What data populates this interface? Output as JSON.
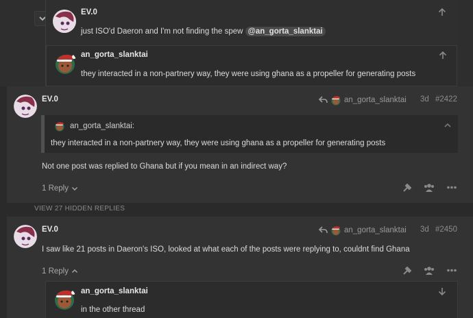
{
  "thread": {
    "top_nested": [
      {
        "username": "EV.0",
        "text": "just ISO'd Daeron and I'm not finding the spew",
        "mention": "@an_gorta_slanktai",
        "avatar": "ev0-avatar"
      },
      {
        "username": "an_gorta_slanktai",
        "text": "they interacted in a non-partnery way, they were using ghana as a propeller for generating posts",
        "avatar": "santa-hat-avatar"
      }
    ],
    "posts": [
      {
        "username": "EV.0",
        "reply_to": "an_gorta_slanktai",
        "age": "3d",
        "number": "#2422",
        "quote_author": "an_gorta_slanktai:",
        "quote_text": "they interacted in a non-partnery way, they were using ghana as a propeller for generating posts",
        "body": "Not one post was replied to Ghana but if you mean in an indirect way?",
        "replies_label": "1 Reply"
      },
      {
        "username": "EV.0",
        "reply_to": "an_gorta_slanktai",
        "age": "3d",
        "number": "#2450",
        "body": "I saw like 21 posts in Daeron's ISO, looked at what each of the posts were replying to, couldnt find Ghana",
        "replies_label": "1 Reply",
        "nested_reply": {
          "username": "an_gorta_slanktai",
          "text": "in the other thread"
        }
      }
    ],
    "hidden_replies_label": "VIEW 27 HIDDEN REPLIES"
  },
  "colors": {
    "page_bg": "#2a2a2a",
    "post_bg": "#333333",
    "nested_bg": "#2c2c2c",
    "text": "#dcdcdc",
    "muted": "#8c8c8c"
  },
  "icons": {
    "collapse": "chevron-down-icon",
    "jump_up": "arrow-up-icon",
    "jump_down": "arrow-down-icon",
    "reply_to": "reply-arrow-icon",
    "admin": "wrench-icon",
    "users": "users-icon",
    "more": "ellipsis-icon",
    "expand": "chevron-down-icon"
  }
}
